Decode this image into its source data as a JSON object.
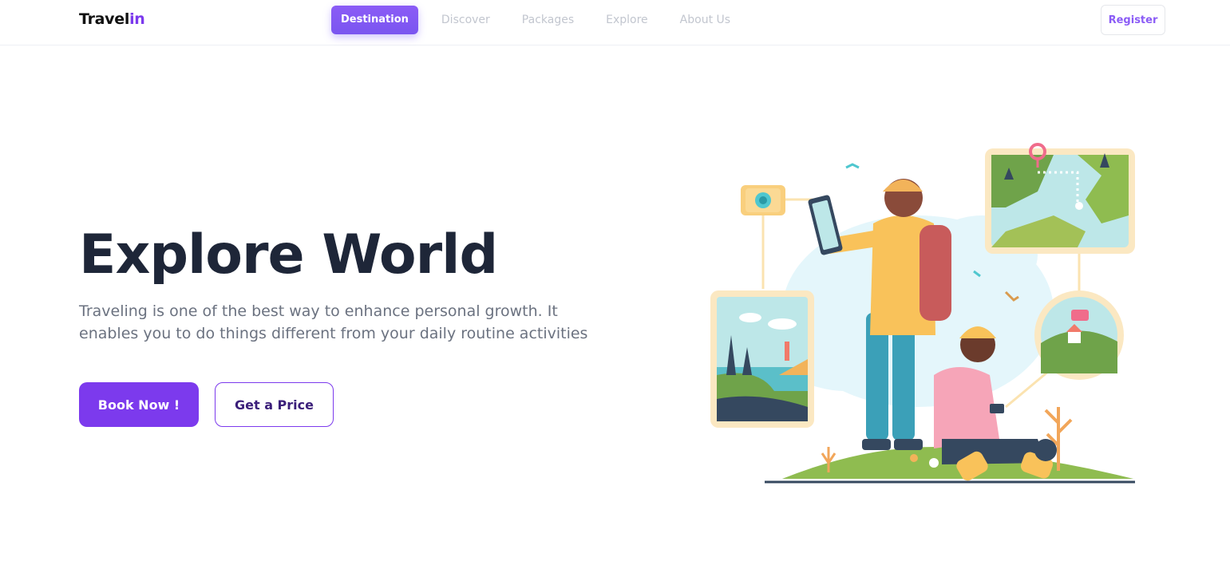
{
  "header": {
    "logo_main": "Travel",
    "logo_accent": "in",
    "nav": [
      {
        "label": "Destination",
        "active": true
      },
      {
        "label": "Discover",
        "active": false
      },
      {
        "label": "Packages",
        "active": false
      },
      {
        "label": "Explore",
        "active": false
      },
      {
        "label": "About Us",
        "active": false
      }
    ],
    "register_label": "Register"
  },
  "hero": {
    "title": "Explore World",
    "description": "Traveling is one of the best way to enhance personal growth. It enables you to do things different from your daily routine activities",
    "primary_button": "Book Now !",
    "secondary_button": "Get a Price"
  },
  "colors": {
    "brand": "#7c3aed",
    "nav_active": "#8b5cf6",
    "title": "#1e2638",
    "muted": "#6b7280"
  },
  "illustration": {
    "icon_name": "travelers-illustration"
  }
}
